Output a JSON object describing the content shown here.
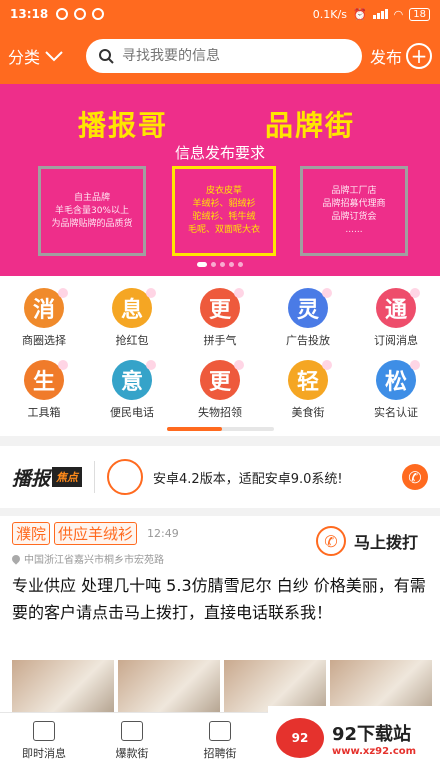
{
  "status": {
    "time": "13:18",
    "speed": "0.1K/s",
    "battery": "18"
  },
  "header": {
    "category_label": "分类",
    "search_placeholder": "寻找我要的信息",
    "publish_label": "发布"
  },
  "banner": {
    "title_left": "播报哥",
    "title_right": "品牌街",
    "subtitle": "信息发布要求",
    "box1": [
      "自主品牌",
      "羊毛含量30%以上",
      "为品牌贴牌的品质货"
    ],
    "box2": [
      "皮衣皮草",
      "羊绒衫、貂绒衫",
      "驼绒衫、牦牛绒",
      "毛呢、双面呢大衣"
    ],
    "box3": [
      "品牌工厂店",
      "品牌招募代理商",
      "品牌订货会",
      "......"
    ]
  },
  "grid": [
    {
      "glyph": "消",
      "label": "商圈选择",
      "color": "#f08a2b"
    },
    {
      "glyph": "息",
      "label": "抢红包",
      "color": "#f5a623"
    },
    {
      "glyph": "更",
      "label": "拼手气",
      "color": "#ee5a3c"
    },
    {
      "glyph": "灵",
      "label": "广告投放",
      "color": "#4a7be6"
    },
    {
      "glyph": "通",
      "label": "订阅消息",
      "color": "#ee4d6b"
    },
    {
      "glyph": "生",
      "label": "工具箱",
      "color": "#f07b2a"
    },
    {
      "glyph": "意",
      "label": "便民电话",
      "color": "#35a3c9"
    },
    {
      "glyph": "更",
      "label": "失物招领",
      "color": "#ee5a3c"
    },
    {
      "glyph": "轻",
      "label": "美食街",
      "color": "#f5a623"
    },
    {
      "glyph": "松",
      "label": "实名认证",
      "color": "#3e8ee6"
    }
  ],
  "news": {
    "logo": "播报",
    "logo_tag": "焦点",
    "text": "安卓4.2版本，适配安卓9.0系统!"
  },
  "post": {
    "tags": [
      "濮院",
      "供应羊绒衫"
    ],
    "time": "12:49",
    "call_label": "马上拨打",
    "location": "中国浙江省嘉兴市桐乡市宏苑路",
    "body": "专业供应 处理几十吨 5.3仿腈雪尼尔 白纱 价格美丽，有需要的客户请点击马上拨打，直接电话联系我！"
  },
  "bottom_nav": [
    {
      "label": "即时消息"
    },
    {
      "label": "爆款街"
    },
    {
      "label": "招聘街"
    }
  ],
  "watermark": {
    "text": "92下载站",
    "url": "www.xz92.com"
  }
}
